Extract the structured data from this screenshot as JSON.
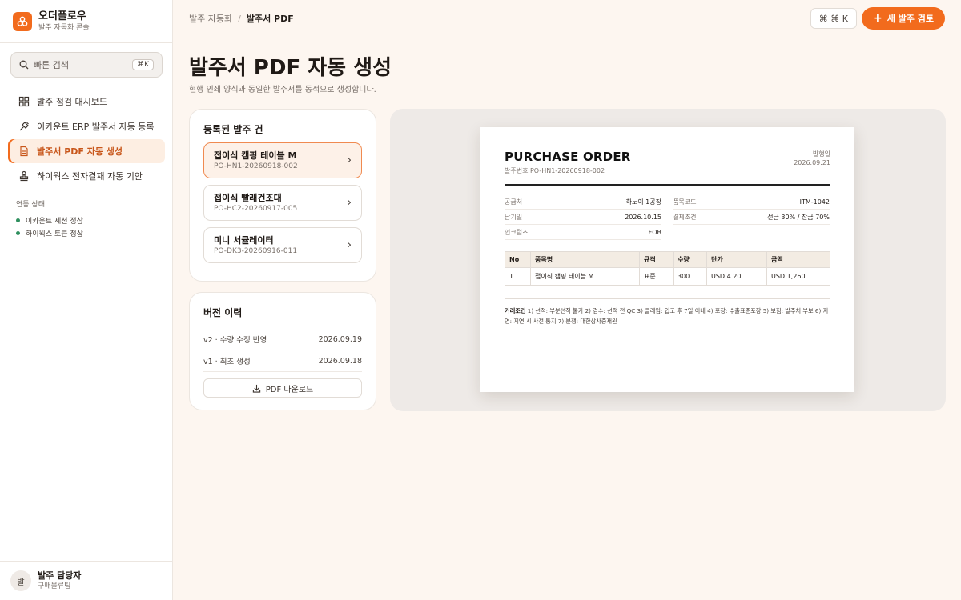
{
  "app": {
    "name": "오더플로우",
    "subtitle": "발주 자동화 콘솔"
  },
  "search": {
    "placeholder": "빠른 검색",
    "shortcut": "⌘K"
  },
  "nav": [
    {
      "label": "발주 점검 대시보드",
      "icon": "grid-icon"
    },
    {
      "label": "이카운트 ERP 발주서 자동 등록",
      "icon": "plug-icon"
    },
    {
      "label": "발주서 PDF 자동 생성",
      "icon": "document-icon",
      "active": true
    },
    {
      "label": "하이웍스 전자결재 자동 기안",
      "icon": "stamp-icon"
    }
  ],
  "integration": {
    "title": "연동 상태",
    "items": [
      "이카운트 세션 정상",
      "하이웍스 토큰 정상"
    ],
    "ok_color": "#2e8f5e"
  },
  "user": {
    "initial": "발",
    "name": "발주 담당자",
    "team": "구매물류팀"
  },
  "breadcrumb": {
    "parent": "발주 자동화",
    "separator": "/",
    "current": "발주서 PDF"
  },
  "header": {
    "command_label": "⌘ ⌘ K",
    "new_review": "새 발주 검토",
    "new_review_icon": "+"
  },
  "page": {
    "title": "발주서 PDF 자동 생성",
    "description": "현행 인쇄 양식과 동일한 발주서를 동적으로 생성합니다."
  },
  "orders": {
    "title": "등록된 발주 건",
    "items": [
      {
        "name": "접이식 캠핑 테이블 M",
        "id": "PO-HN1-20260918-002",
        "selected": true
      },
      {
        "name": "접이식 빨래건조대",
        "id": "PO-HC2-20260917-005"
      },
      {
        "name": "미니 서큘레이터",
        "id": "PO-DK3-20260916-011"
      }
    ]
  },
  "history": {
    "title": "버전 이력",
    "items": [
      {
        "label": "v2 · 수량 수정 반영",
        "date": "2026.09.19"
      },
      {
        "label": "v1 · 최초 생성",
        "date": "2026.09.18"
      }
    ],
    "download_label": "PDF 다운로드"
  },
  "po": {
    "title": "PURCHASE ORDER",
    "number": "발주번호 PO-HN1-20260918-002",
    "date_label": "발행일",
    "date": "2026.09.21",
    "info_left": [
      {
        "k": "공급처",
        "v": "하노이 1공장"
      },
      {
        "k": "납기일",
        "v": "2026.10.15"
      },
      {
        "k": "인코텀즈",
        "v": "FOB"
      }
    ],
    "info_right": [
      {
        "k": "품목코드",
        "v": "ITM-1042"
      },
      {
        "k": "결제조건",
        "v": "선금 30% / 잔금 70%"
      }
    ],
    "table": {
      "headers": [
        "No",
        "품목명",
        "규격",
        "수량",
        "단가",
        "금액"
      ],
      "rows": [
        [
          "1",
          "접이식 캠핑 테이블 M",
          "표준",
          "300",
          "USD 4.20",
          "USD 1,260"
        ]
      ]
    },
    "terms_label": "거래조건",
    "terms_text": "1) 선적: 부분선적 불가 2) 검수: 선적 전 QC 3) 클레임: 입고 후 7일 이내 4) 포장: 수출표준포장 5) 보험: 발주처 부보 6) 지연: 지연 시 사전 통지 7) 분쟁: 대한상사중재원"
  },
  "colors": {
    "accent": "#f26b1d",
    "accent_soft": "#fdeee2",
    "background": "#fdf6f0"
  }
}
